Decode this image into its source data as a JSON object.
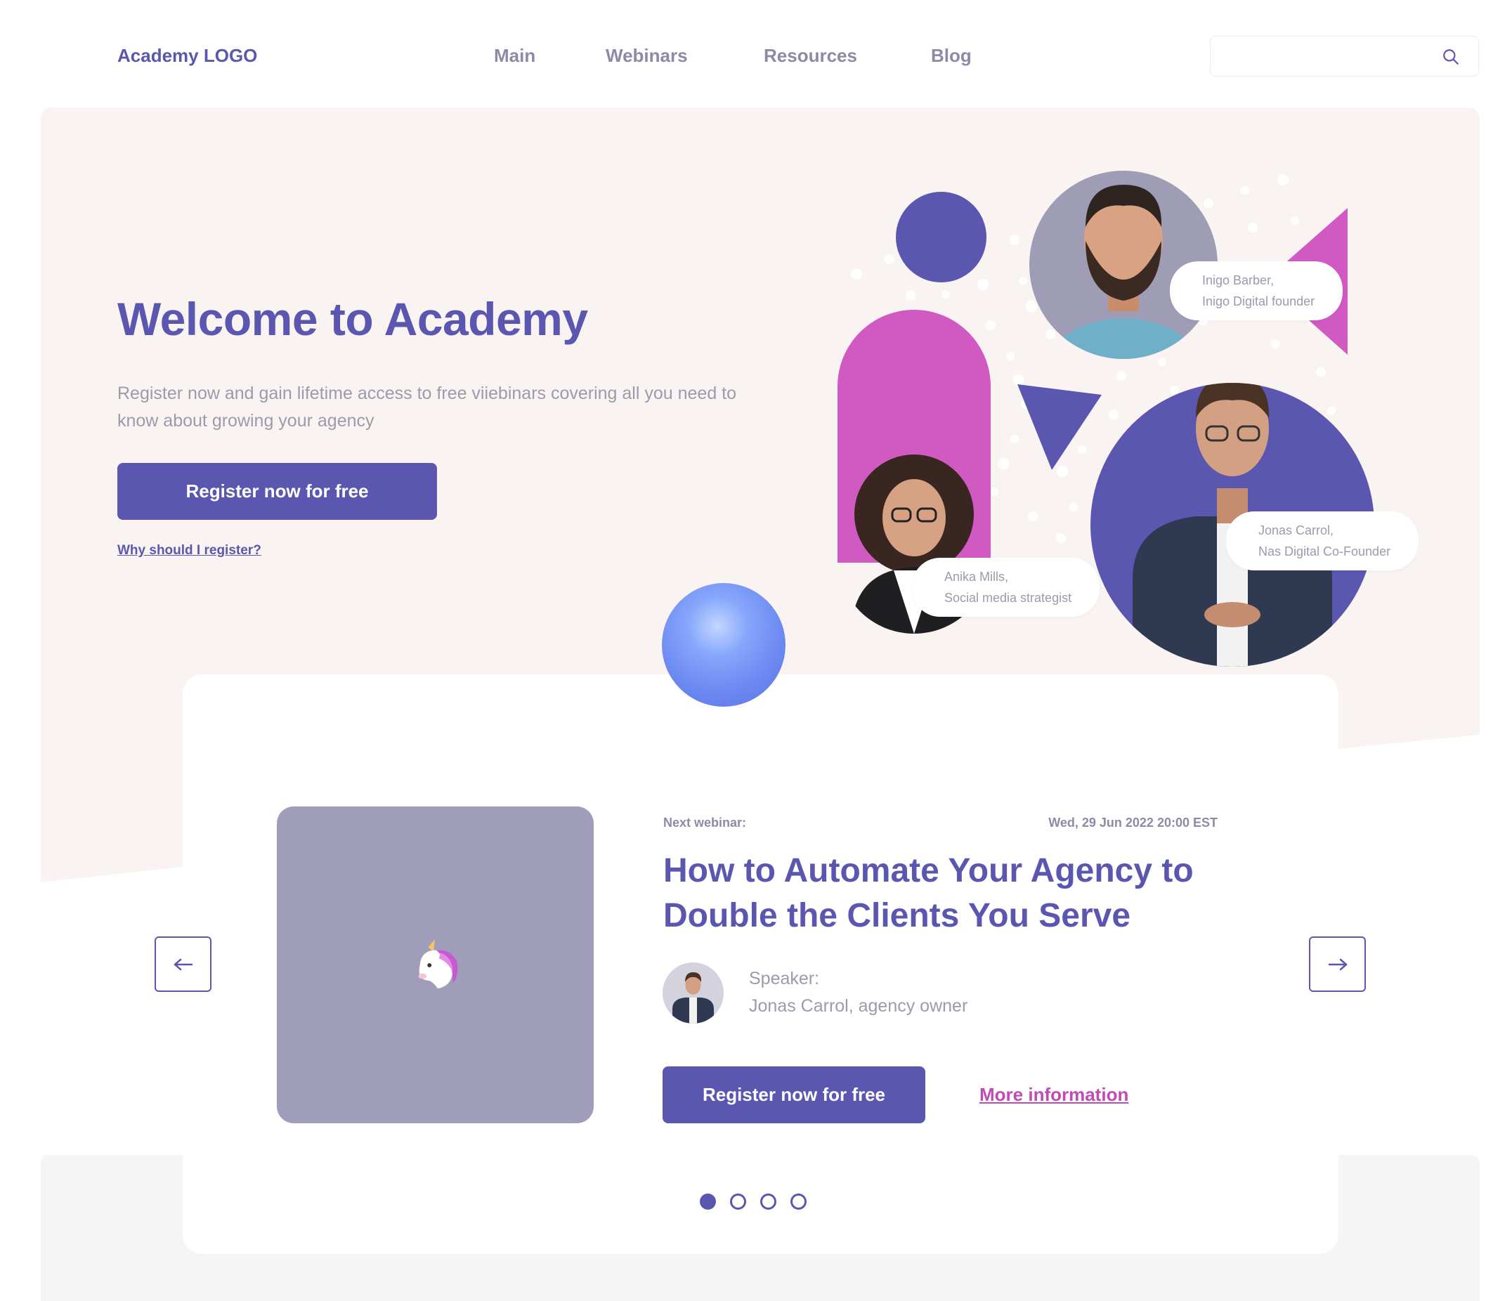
{
  "header": {
    "logo": "Academy LOGO",
    "nav": [
      {
        "label": "Main"
      },
      {
        "label": "Webinars"
      },
      {
        "label": "Resources"
      },
      {
        "label": "Blog"
      }
    ],
    "search": {
      "placeholder": "",
      "icon": "search-icon"
    }
  },
  "hero": {
    "title": "Welcome to Academy",
    "subtitle": "Register now and gain lifetime access to free viiebinars covering all you need to know about growing your agency",
    "cta": "Register now for free",
    "link": "Why should I register?",
    "people": [
      {
        "name": "Inigo Barber,",
        "role": "Inigo Digital founder"
      },
      {
        "name": "Jonas Carrol,",
        "role": "Nas Digital Co-Founder"
      },
      {
        "name": "Anika Mills,",
        "role": "Social media strategist"
      }
    ]
  },
  "webinar": {
    "next_label": "Next webinar:",
    "date": "Wed, 29 Jun 2022 20:00 EST",
    "title": "How to Automate Your Agency to Double the Clients You Serve",
    "speaker_label": "Speaker:",
    "speaker_name": "Jonas Carrol, agency owner",
    "cta": "Register now for free",
    "more": "More information",
    "thumbnail_icon": "unicorn-icon",
    "slides": {
      "total": 4,
      "active": 1
    }
  },
  "colors": {
    "primary": "#5b57b0",
    "pink": "#d05ac2",
    "link_pink": "#c14bb6",
    "hero_bg": "#f9f4f1",
    "muted_text": "#9c9aab"
  }
}
